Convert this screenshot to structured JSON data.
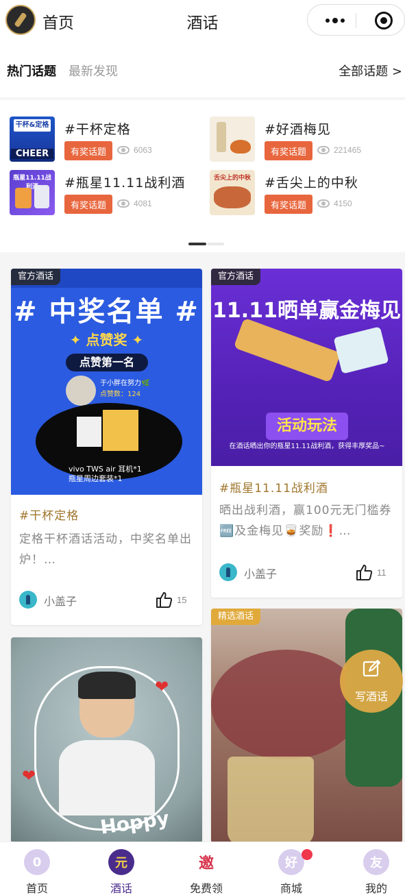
{
  "header": {
    "home_label": "首页",
    "title": "酒话"
  },
  "tabs": {
    "hot": "热门话题",
    "latest": "最新发现",
    "all": "全部话题 >"
  },
  "topics": [
    {
      "name": "#干杯定格",
      "badge": "有奖话题",
      "views": "6063",
      "thumb_text": "干杯&定格",
      "thumb_sub": "CHEER"
    },
    {
      "name": "#好酒梅见",
      "badge": "有奖话题",
      "views": "221465"
    },
    {
      "name": "#瓶星11.11战利酒",
      "badge": "有奖话题",
      "views": "4081",
      "thumb_text": "瓶星11.11战利酒"
    },
    {
      "name": "#舌尖上的中秋",
      "badge": "有奖话题",
      "views": "4150",
      "thumb_text": "舌尖上的中秋"
    }
  ],
  "feed": [
    {
      "tag": "官方酒话",
      "art": {
        "title": "# 中奖名单 #",
        "sub": "✦ 点赞奖 ✦",
        "pill": "点赞第一名",
        "user": "于小胖在努力🌿",
        "count": "点赞数：124",
        "prize_1": "vivo TWS air 耳机*1",
        "prize_2": "瓶星周边套装*1"
      },
      "topic": "#干杯定格",
      "desc": "定格干杯酒话活动，中奖名单出炉！…",
      "author": "小盖子",
      "likes": "15"
    },
    {
      "tag": "官方酒话",
      "art": {
        "title": "11.11晒单赢金梅见",
        "banner": "活动玩法",
        "note": "在酒话晒出你的瓶星11.11战利酒，获得丰厚奖品~"
      },
      "topic": "#瓶星11.11战利酒",
      "desc": "晒出战利酒，赢100元无门槛券🆓及金梅见🥃奖励❗…",
      "author": "小盖子",
      "likes": "11"
    },
    {
      "art": {
        "text": "Hoppy"
      }
    },
    {
      "tag": "精选酒话"
    }
  ],
  "fab": {
    "label": "写酒话"
  },
  "nav": [
    {
      "label": "首页",
      "glyph": "0"
    },
    {
      "label": "酒话",
      "glyph": "元"
    },
    {
      "label": "免费领",
      "glyph": "邀"
    },
    {
      "label": "商城",
      "glyph": "好"
    },
    {
      "label": "我的",
      "glyph": "友"
    }
  ],
  "colors": {
    "accent": "#e8663d",
    "brand": "#4a2c8c",
    "topic_link": "#a0762c",
    "fab": "#e0aa46"
  }
}
